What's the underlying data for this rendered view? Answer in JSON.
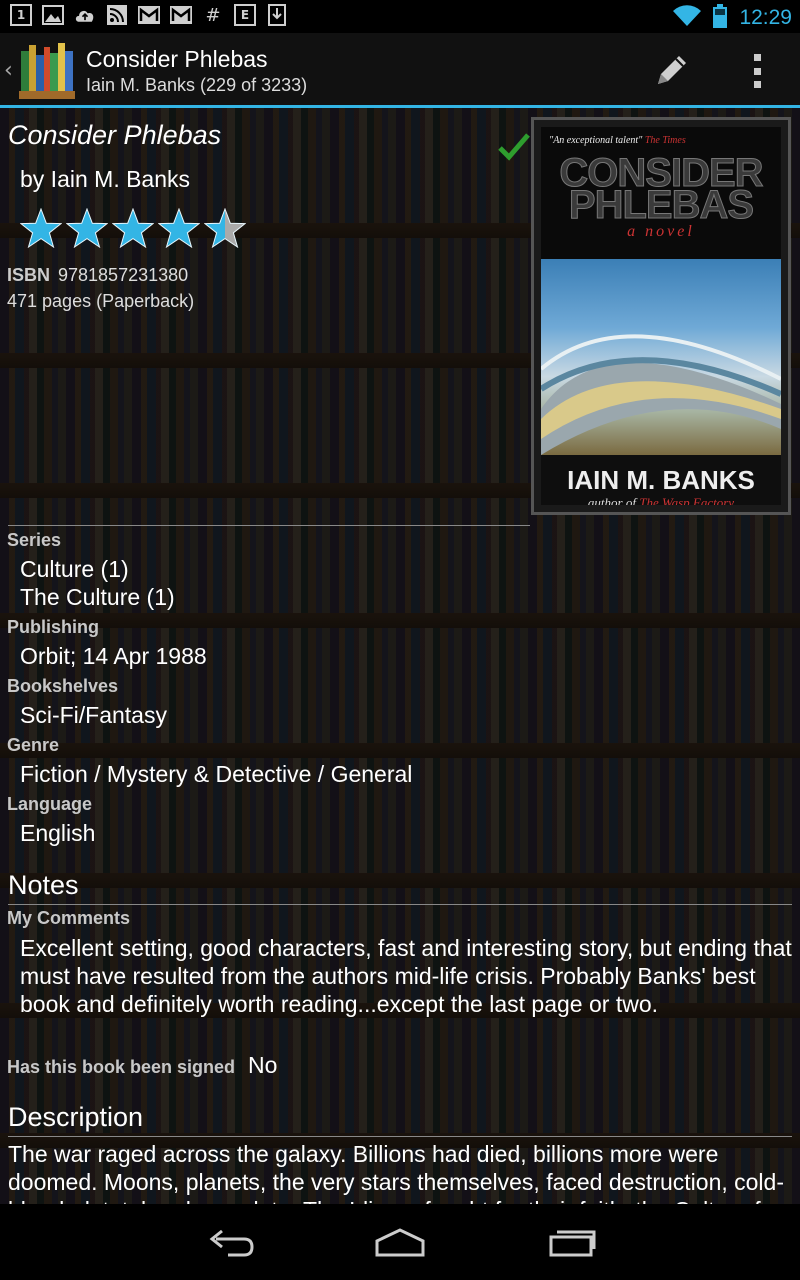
{
  "status_bar": {
    "time": "12:29",
    "notification_icons": [
      "1",
      "image-icon",
      "cloud-upload-icon",
      "rss-icon",
      "gmail-icon",
      "gmail-icon",
      "#",
      "E",
      "download-icon"
    ]
  },
  "action_bar": {
    "title": "Consider Phlebas",
    "subtitle": "Iain M. Banks (229 of 3233)"
  },
  "book": {
    "title": "Consider Phlebas",
    "author_line": "by Iain M. Banks",
    "rating": 4.5,
    "rating_max": 5,
    "isbn_label": "ISBN",
    "isbn": "9781857231380",
    "pages": "471 pages  (Paperback)",
    "read": true,
    "cover": {
      "tagline": "\"An exceptional talent\"",
      "tagline_source": "The Times",
      "title_line1": "CONSIDER",
      "title_line2": "PHLEBAS",
      "subtitle": "a novel",
      "author": "IAIN M. BANKS",
      "footer": "author of",
      "footer_book": "The Wasp Factory"
    }
  },
  "details": {
    "series_label": "Series",
    "series": [
      "Culture (1)",
      "The Culture (1)"
    ],
    "publishing_label": "Publishing",
    "publishing": "Orbit; 14 Apr 1988",
    "bookshelves_label": "Bookshelves",
    "bookshelves": "Sci-Fi/Fantasy",
    "genre_label": "Genre",
    "genre": "Fiction / Mystery & Detective / General",
    "language_label": "Language",
    "language": "English"
  },
  "notes": {
    "heading": "Notes",
    "comments_label": "My Comments",
    "comments": "Excellent setting, good characters, fast and interesting story, but ending that must have resulted from the authors mid-life crisis. Probably Banks' best book and definitely worth reading...except the last page or two.",
    "signed_label": "Has this book been signed",
    "signed": "No"
  },
  "description": {
    "heading": "Description",
    "text": "The war raged across the galaxy. Billions had died, billions more were doomed. Moons, planets, the very stars themselves, faced destruction, cold-blooded, total and complete. The Idirans fought for their faith; the Culture for its moral right to exist."
  },
  "colors": {
    "accent": "#33b5e5",
    "star": "#33b5e5",
    "check": "#2e9d2e"
  }
}
